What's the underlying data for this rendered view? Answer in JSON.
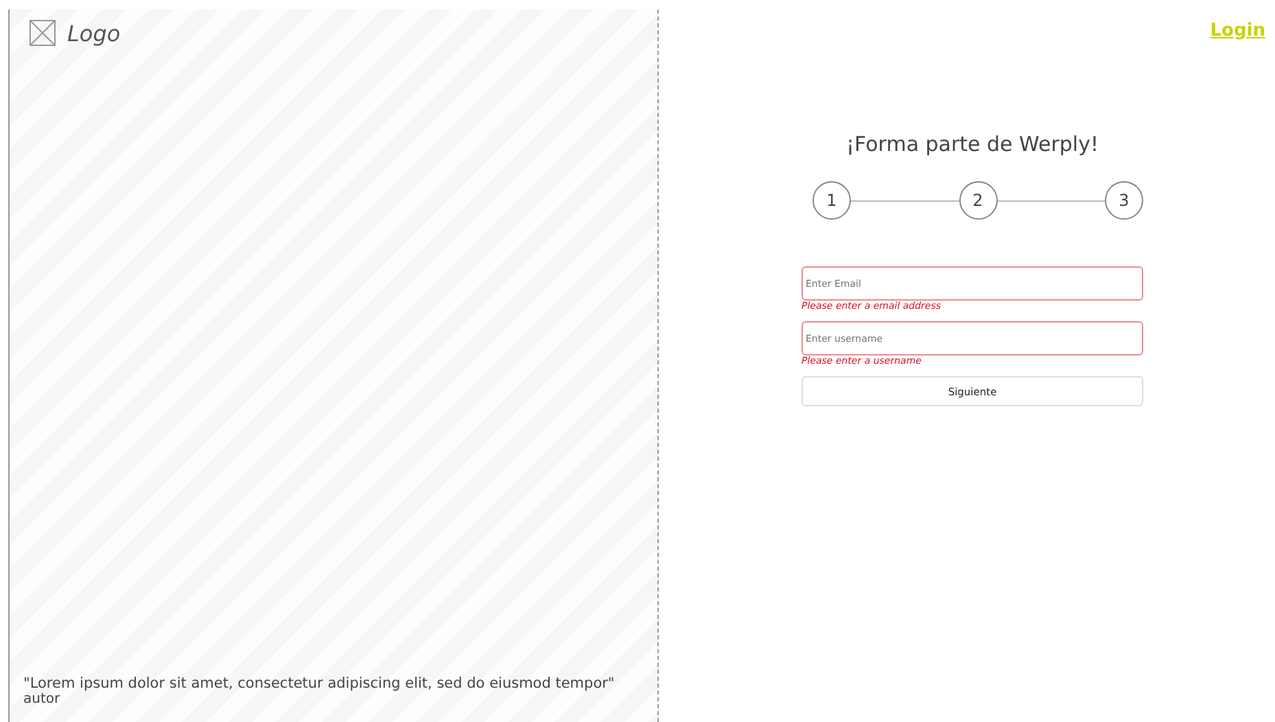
{
  "hero": {
    "logo": "Logo",
    "quote": "\"Lorem ipsum dolor sit amet, consectetur adipiscing elit, sed do eiusmod tempor\"",
    "author": "autor"
  },
  "header": {
    "login_link": "Login"
  },
  "form": {
    "title": "¡Forma parte de Werply!",
    "steps": [
      "1",
      "2",
      "3"
    ],
    "fields": [
      {
        "placeholder": "Enter Email",
        "error": "Please enter a email address"
      },
      {
        "placeholder": "Enter username",
        "error": "Please enter a username"
      }
    ],
    "submit": "Siguiente"
  }
}
